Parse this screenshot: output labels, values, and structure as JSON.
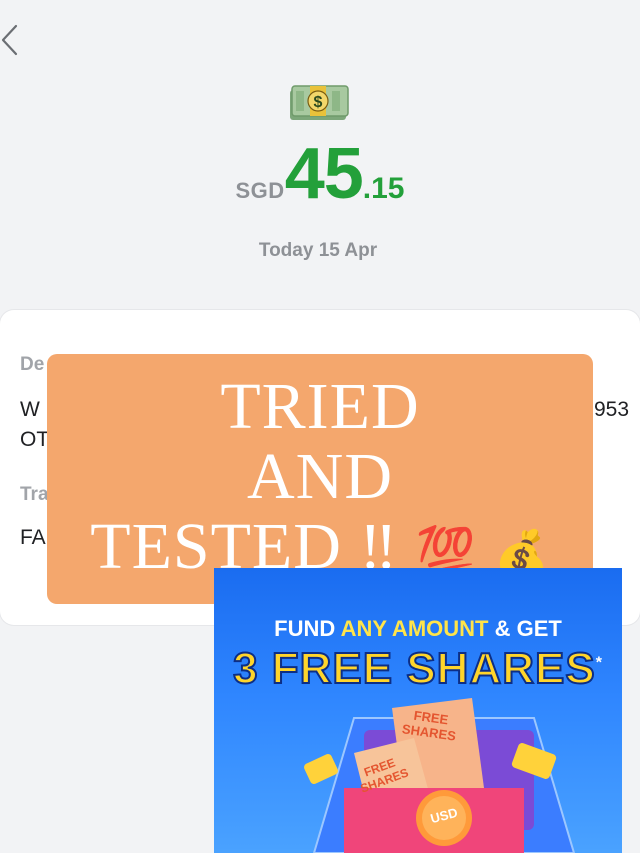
{
  "header": {
    "back_icon": "chevron-left-icon"
  },
  "icon": {
    "name": "money-banknote-icon"
  },
  "amount": {
    "currency": "SGD",
    "integer": "45",
    "decimal": ".15",
    "color": "#23a03a"
  },
  "date": "Today 15 Apr",
  "details": {
    "label_1": "De",
    "value_1a": "W",
    "value_1b": "OT",
    "value_1_tail": "953",
    "label_2": "Tra",
    "value_2": "FA"
  },
  "overlay": {
    "line1": "TRIED",
    "line2": "AND",
    "line3": "TESTED ‼",
    "emoji1": "💯",
    "emoji2": "💰",
    "bg_color": "#f4a76d"
  },
  "promo": {
    "headline_pre": "FUND ",
    "headline_highlight": "ANY AMOUNT",
    "headline_post": " & GET",
    "big_text": "3 FREE SHARES",
    "asterisk": "*",
    "ticket1": "FREE SHARES",
    "ticket2": "FREE SHARES",
    "coin": "USD"
  }
}
